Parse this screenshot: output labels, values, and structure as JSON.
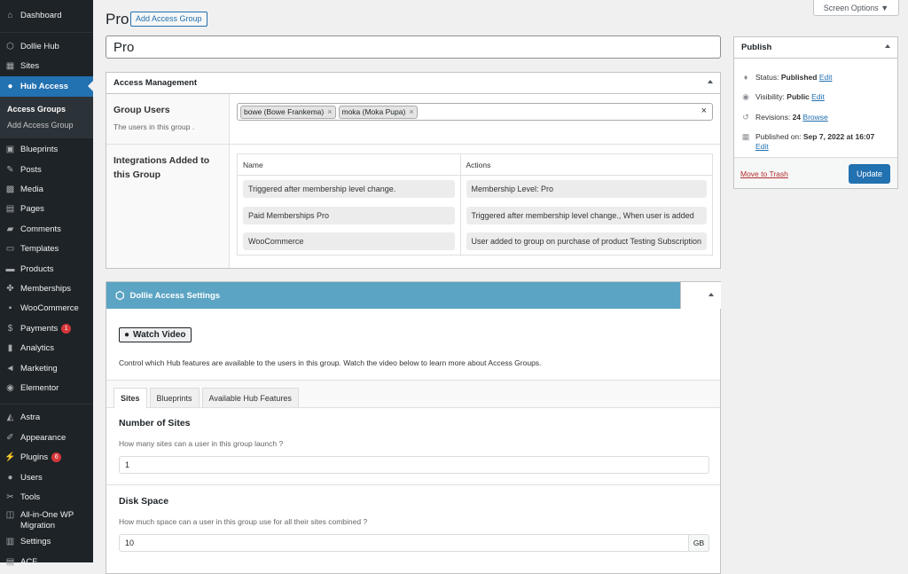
{
  "sidebar": {
    "items_top": [
      {
        "label": "Dashboard",
        "icon": "dashboard-icon",
        "glyph": "⌂"
      }
    ],
    "items_mid": [
      {
        "label": "Dollie Hub",
        "icon": "hub-icon",
        "glyph": "⬡"
      },
      {
        "label": "Sites",
        "icon": "sites-icon",
        "glyph": "▦"
      },
      {
        "label": "Hub Access",
        "icon": "users-icon",
        "glyph": "👥"
      }
    ],
    "submenu": [
      "Access Groups",
      "Add Access Group"
    ],
    "items_bottom": [
      {
        "label": "Blueprints",
        "icon": "blueprints-icon",
        "glyph": "▣"
      },
      {
        "label": "Posts",
        "icon": "pin-icon",
        "glyph": "✎"
      },
      {
        "label": "Media",
        "icon": "media-icon",
        "glyph": "▩"
      },
      {
        "label": "Pages",
        "icon": "pages-icon",
        "glyph": "▤"
      },
      {
        "label": "Comments",
        "icon": "comments-icon",
        "glyph": "▰"
      },
      {
        "label": "Templates",
        "icon": "folder-icon",
        "glyph": "▭"
      },
      {
        "label": "Products",
        "icon": "archive-icon",
        "glyph": "▬"
      },
      {
        "label": "Memberships",
        "icon": "groups-icon",
        "glyph": "✤"
      },
      {
        "label": "WooCommerce",
        "icon": "woocommerce-icon",
        "glyph": "▪"
      },
      {
        "label": "Payments",
        "icon": "dollar-icon",
        "glyph": "$",
        "badge": "1"
      },
      {
        "label": "Analytics",
        "icon": "bar-chart-icon",
        "glyph": "▮"
      },
      {
        "label": "Marketing",
        "icon": "megaphone-icon",
        "glyph": "◄"
      },
      {
        "label": "Elementor",
        "icon": "elementor-icon",
        "glyph": "◉"
      }
    ],
    "items_lower": [
      {
        "label": "Astra",
        "icon": "astra-icon",
        "glyph": "◭"
      },
      {
        "label": "Appearance",
        "icon": "brush-icon",
        "glyph": "✐"
      },
      {
        "label": "Plugins",
        "icon": "plugin-icon",
        "glyph": "⚡",
        "badge": "6"
      },
      {
        "label": "Users",
        "icon": "user-icon",
        "glyph": "●"
      },
      {
        "label": "Tools",
        "icon": "wrench-icon",
        "glyph": "✂"
      },
      {
        "label": "All-in-One WP Migration",
        "icon": "migration-icon",
        "glyph": "◫"
      },
      {
        "label": "Settings",
        "icon": "settings-icon",
        "glyph": "▥"
      },
      {
        "label": "ACF",
        "icon": "acf-icon",
        "glyph": "▤"
      }
    ]
  },
  "header": {
    "title": "Pro",
    "add_button": "Add Access Group",
    "screen_options": "Screen Options ▼",
    "post_title": "Pro"
  },
  "access_management": {
    "title": "Access Management",
    "group_users_label": "Group Users",
    "group_users_desc": "The users in this group .",
    "tags": [
      "bowe (Bowe Frankema)",
      "moka (Moka Pupa)"
    ],
    "integrations_label": "Integrations Added to this Group",
    "columns": [
      "Name",
      "Actions"
    ],
    "rows": [
      {
        "name": "Triggered after membership level change.",
        "action": "Membership Level: Pro"
      },
      {
        "name": "Paid Memberships Pro",
        "action": "Triggered after membership level change., When user is added"
      },
      {
        "name": "WooCommerce",
        "action": "User added to group on purchase of product Testing Subscription"
      }
    ]
  },
  "dollie_settings": {
    "title": "Dollie Access Settings",
    "watch_video": "Watch Video",
    "control_text": "Control which Hub features are available to the users in this group. Watch the video below to learn more about Access Groups.",
    "tabs": [
      "Sites",
      "Blueprints",
      "Available Hub Features"
    ],
    "fields": [
      {
        "title": "Number of Sites",
        "desc": "How many sites can a user in this group launch ?",
        "value": "1",
        "unit": ""
      },
      {
        "title": "Disk Space",
        "desc": "How much space can a user in this group use for all their sites combined ?",
        "value": "10",
        "unit": "GB"
      }
    ]
  },
  "publish": {
    "title": "Publish",
    "status_label": "Status: ",
    "status_value": "Published",
    "visibility_label": "Visibility: ",
    "visibility_value": "Public",
    "revisions_label": "Revisions: ",
    "revisions_value": "24",
    "browse": "Browse",
    "published_label": "Published on: ",
    "published_value": "Sep 7, 2022 at 16:07",
    "edit": "Edit",
    "trash": "Move to Trash",
    "update": "Update"
  }
}
